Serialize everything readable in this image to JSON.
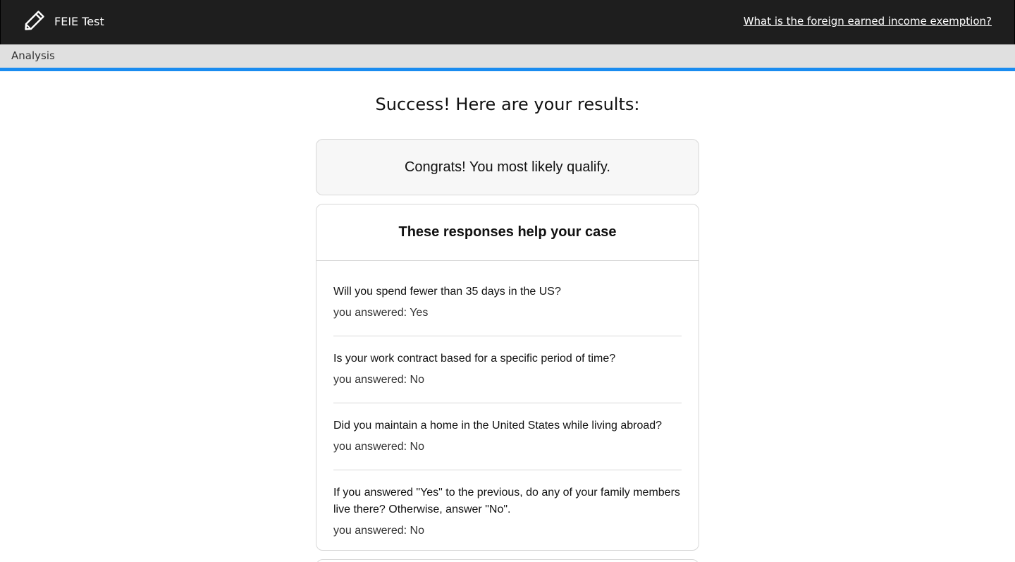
{
  "header": {
    "brand_icon": "pencil-icon",
    "title": "FEIE Test",
    "help_link": "What is the foreign earned income exemption?"
  },
  "subheader": {
    "label": "Analysis",
    "progress_percent": 100,
    "progress_color": "#1a8cf0"
  },
  "main": {
    "title": "Success! Here are your results:",
    "result": "Congrats! You most likely qualify.",
    "responses": {
      "title": "These responses help your case",
      "items": [
        {
          "question": "Will you spend fewer than 35 days in the US?",
          "answer": "you answered: Yes"
        },
        {
          "question": "Is your work contract based for a specific period of time?",
          "answer": "you answered: No"
        },
        {
          "question": "Did you maintain a home in the United States while living abroad?",
          "answer": "you answered: No"
        },
        {
          "question": "If you answered \"Yes\" to the previous, do any of your family members live there? Otherwise, answer \"No\".",
          "answer": "you answered: No"
        }
      ]
    }
  },
  "colors": {
    "topbar": "#1e1e1e",
    "subbar": "#e0e0e0",
    "accent": "#1a8cf0"
  }
}
